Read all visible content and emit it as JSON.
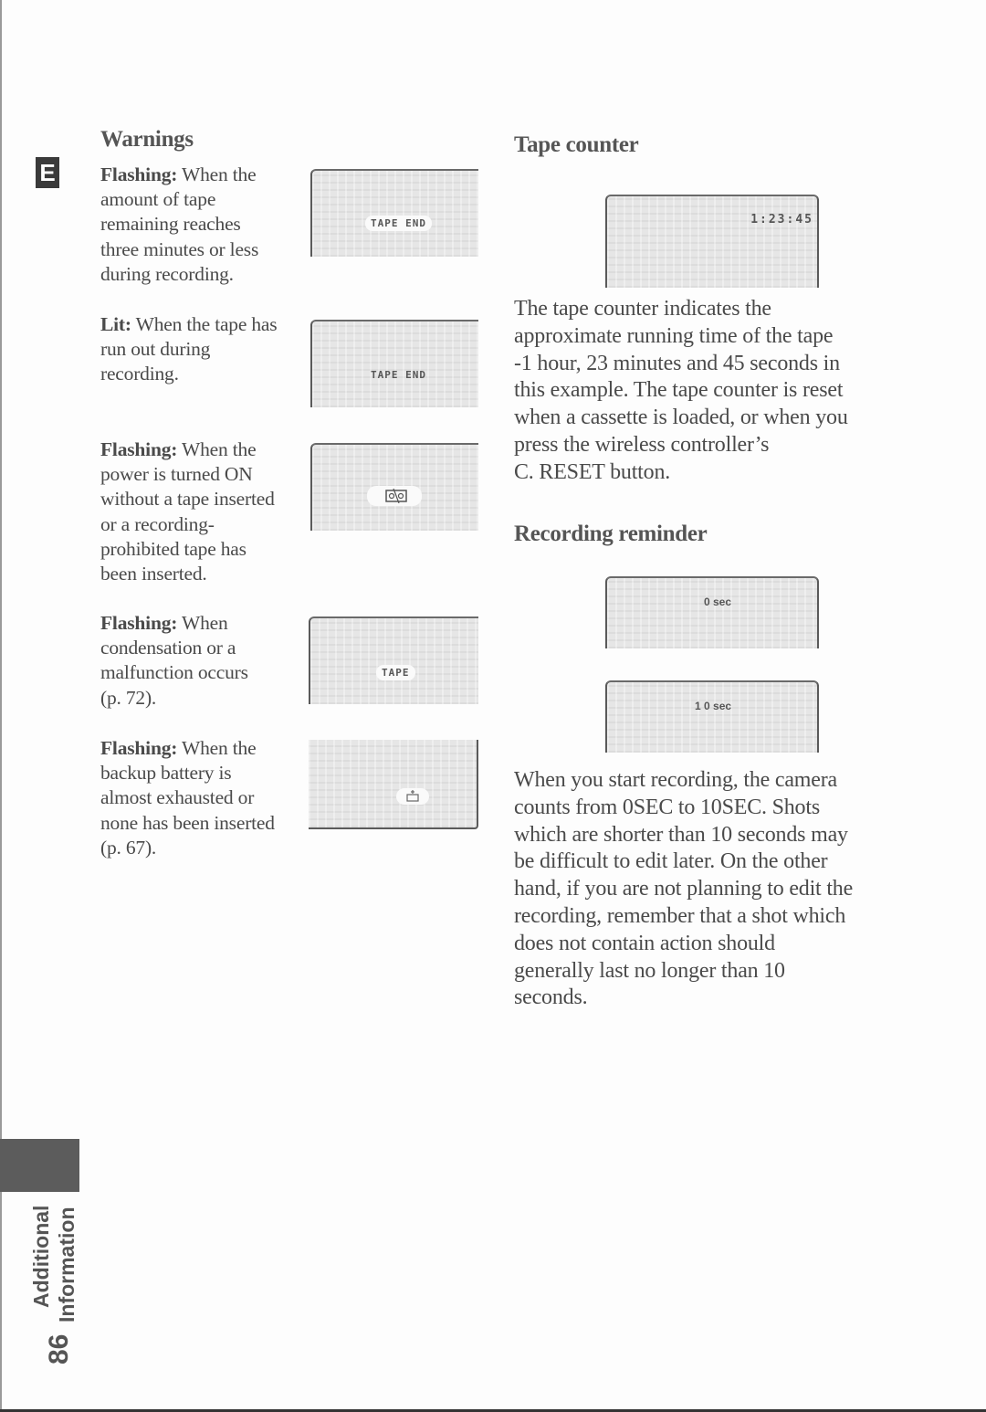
{
  "page": {
    "language_badge": "E",
    "section_tab": {
      "line1": "Additional",
      "line2": "Information"
    },
    "page_number": "86"
  },
  "warnings": {
    "heading": "Warnings",
    "items": [
      {
        "state": "Flashing:",
        "lines": [
          "When the",
          "amount of tape",
          "remaining reaches",
          "three minutes or less",
          "during recording."
        ],
        "display": "TAPE END",
        "display_icon": "tape-end-text"
      },
      {
        "state": "Lit:",
        "lines": [
          "When the tape has",
          "run out during",
          "recording."
        ],
        "display": "TAPE END",
        "display_icon": "tape-end-text"
      },
      {
        "state": "Flashing:",
        "lines": [
          "When the",
          "power is turned ON",
          "without a tape inserted",
          "or a recording-",
          "prohibited tape has",
          "been inserted."
        ],
        "display": "",
        "display_icon": "cassette-prohibited-icon"
      },
      {
        "state": "Flashing:",
        "lines": [
          "When",
          "condensation or a",
          "malfunction occurs",
          "(p. 72)."
        ],
        "display": "TAPE",
        "display_icon": "tape-text"
      },
      {
        "state": "Flashing:",
        "lines": [
          "When the",
          "backup battery is",
          "almost exhausted or",
          "none has been inserted",
          "(p. 67)."
        ],
        "display": "",
        "display_icon": "backup-battery-icon"
      }
    ]
  },
  "tape_counter": {
    "heading": "Tape counter",
    "display": "1:23:45",
    "lines": [
      "The tape counter indicates the",
      "approximate running time of the tape",
      "-1 hour, 23 minutes and 45 seconds in",
      "this example. The tape counter is reset",
      "when a cassette is loaded, or when you",
      "press the wireless controller’s",
      "C. RESET button."
    ]
  },
  "recording_reminder": {
    "heading": "Recording reminder",
    "display_start": "0 sec",
    "display_end": "1 0 sec",
    "arrow_icon": "arrow-down",
    "lines": [
      "When you start recording, the camera",
      "counts from 0SEC to 10SEC. Shots",
      "which are shorter than 10 seconds may",
      "be difficult to edit later. On the other",
      "hand, if you are not planning to edit the",
      "recording, remember that a shot which",
      "does not contain action should",
      "generally last no longer than 10",
      "seconds."
    ]
  }
}
